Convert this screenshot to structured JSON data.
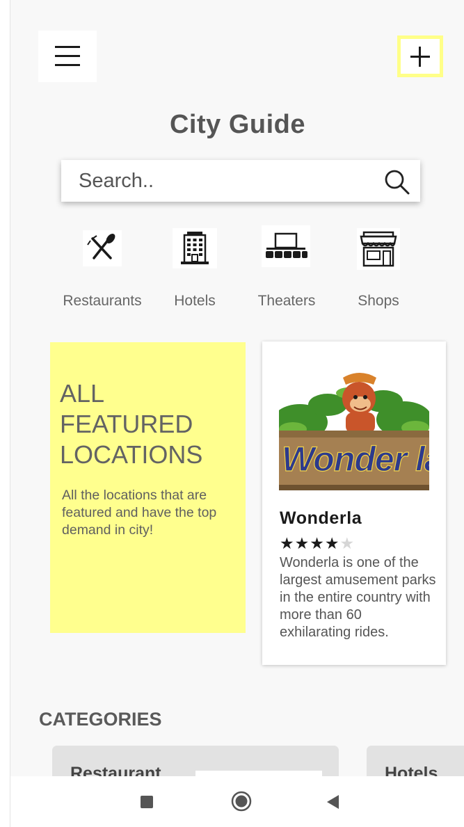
{
  "app": {
    "title": "City Guide"
  },
  "search": {
    "placeholder": "Search.."
  },
  "categories_top": [
    {
      "label": "Restaurants",
      "icon": "fork-knife-icon"
    },
    {
      "label": "Hotels",
      "icon": "hotel-building-icon"
    },
    {
      "label": "Theaters",
      "icon": "theater-icon"
    },
    {
      "label": "Shops",
      "icon": "shop-icon"
    }
  ],
  "featured": {
    "title": "ALL FEATURED LOCATIONS",
    "description": "All the locations that are featured and have the top demand in city!",
    "color": "#ffff8e"
  },
  "location_card": {
    "image_text": "Wonder la",
    "title": "Wonderla",
    "rating": 4,
    "rating_max": 5,
    "description": "Wonderla is one of the largest amusement parks in the entire country with more than 60 exhilarating rides."
  },
  "categories_section": {
    "heading": "CATEGORIES",
    "cards": [
      "Restaurant",
      "Hotels"
    ]
  },
  "colors": {
    "accent": "#ffff88",
    "background": "#f8f8f8",
    "category_card": "#e2e2e2"
  },
  "nav": {
    "icons": [
      "recent-apps-icon",
      "home-icon",
      "back-icon"
    ]
  }
}
